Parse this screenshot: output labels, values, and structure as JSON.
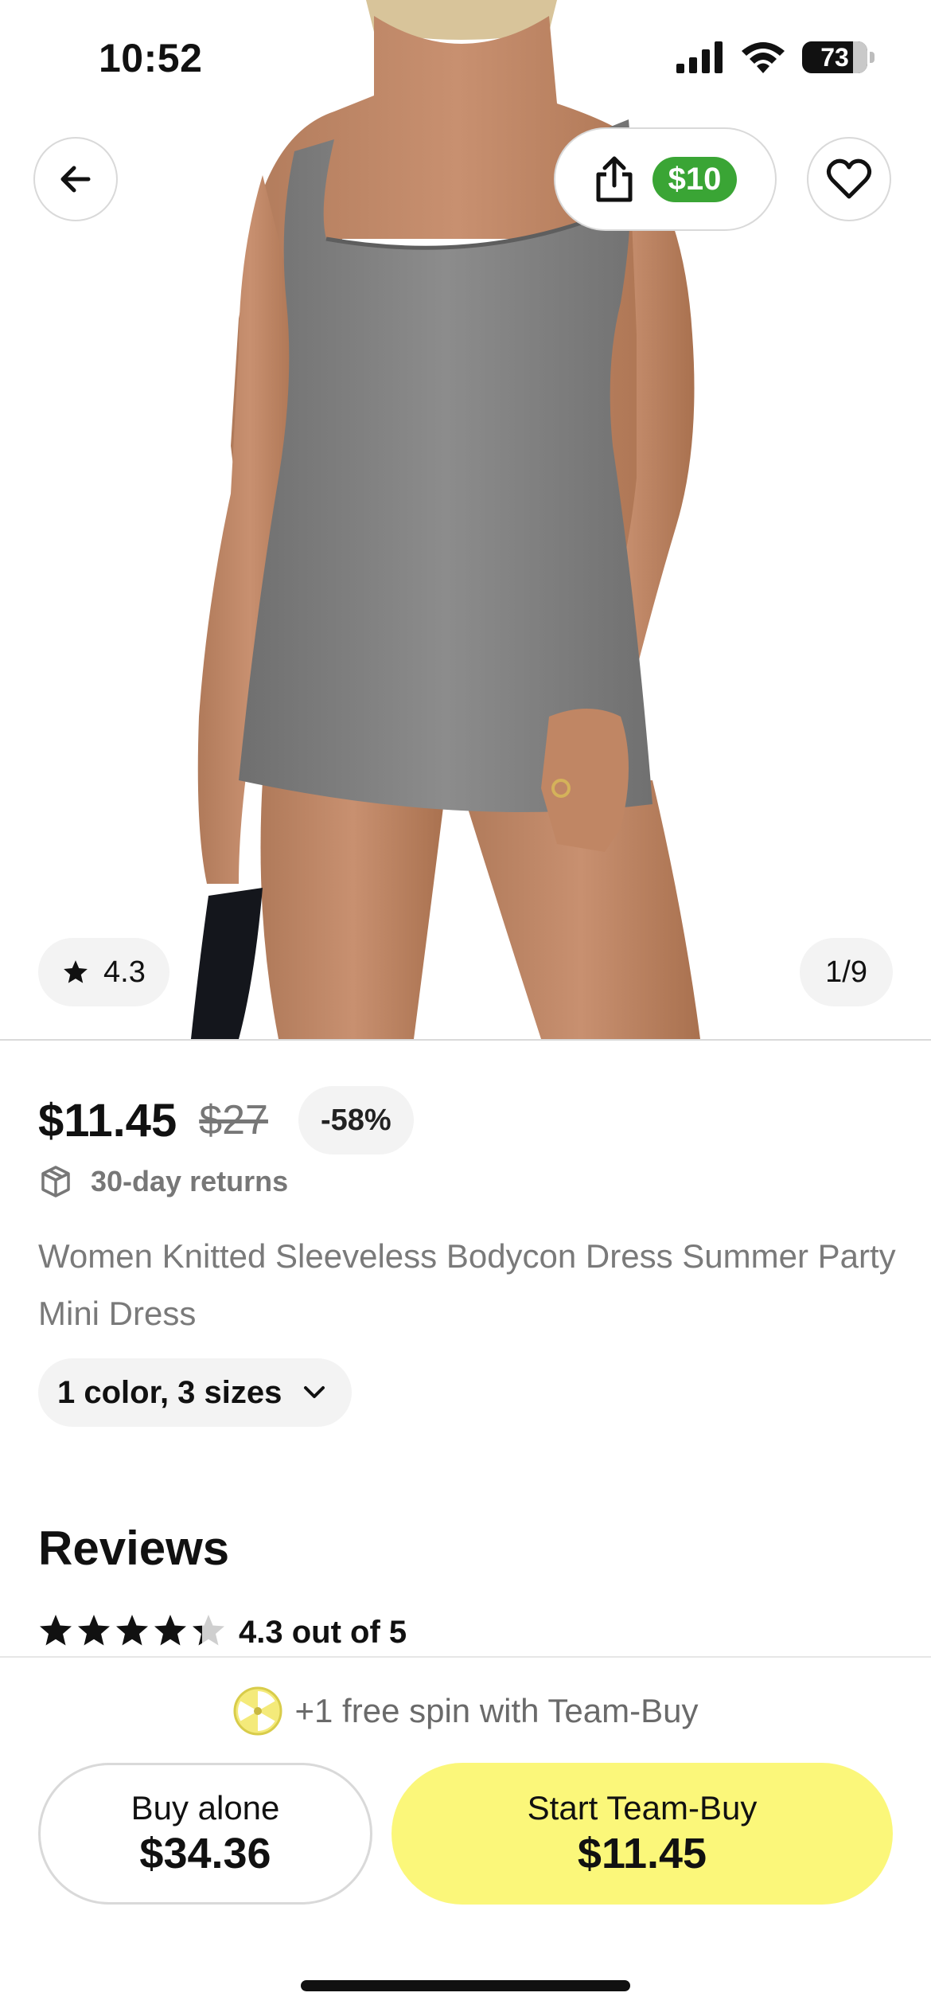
{
  "status_bar": {
    "time": "10:52",
    "battery": "73"
  },
  "header": {
    "share_reward": "$10"
  },
  "gallery": {
    "rating": "4.3",
    "page_indicator": "1/9"
  },
  "product": {
    "price": "$11.45",
    "original_price": "$27",
    "discount": "-58%",
    "returns": "30-day returns",
    "title": "Women Knitted Sleeveless Bodycon Dress Summer Party Mini Dress",
    "variants": "1 color, 3 sizes"
  },
  "reviews": {
    "heading": "Reviews",
    "rating_value": 4.3,
    "rating_text": "4.3 out of 5"
  },
  "bottom_bar": {
    "promo": "+1 free spin with Team-Buy",
    "buy_alone_label": "Buy alone",
    "buy_alone_price": "$34.36",
    "team_buy_label": "Start Team-Buy",
    "team_buy_price": "$11.45"
  },
  "colors": {
    "accent_yellow": "#fbf77a",
    "reward_green": "#3aa535",
    "chip_bg": "#f3f3f3",
    "dress_gray": "#868686"
  },
  "icons": [
    "back-arrow-icon",
    "share-icon",
    "heart-icon",
    "star-icon",
    "box-icon",
    "chevron-down-icon",
    "spin-wheel-icon"
  ]
}
